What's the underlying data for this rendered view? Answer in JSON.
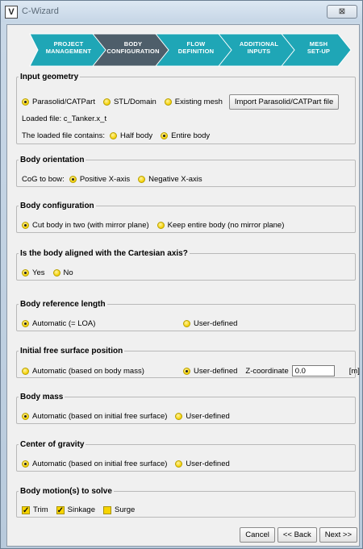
{
  "window": {
    "title": "C-Wizard",
    "close_glyph": "⊠"
  },
  "wizard_steps": [
    {
      "line1": "Project",
      "line2": "Management",
      "active": false
    },
    {
      "line1": "Body",
      "line2": "Configuration",
      "active": true
    },
    {
      "line1": "Flow",
      "line2": "Definition",
      "active": false
    },
    {
      "line1": "Additional",
      "line2": "Inputs",
      "active": false
    },
    {
      "line1": "Mesh",
      "line2": "Set-up",
      "active": false
    }
  ],
  "colors": {
    "step": "#1fa6b6",
    "step_active": "#4e5e6a",
    "accent": "#f5d000"
  },
  "input_geometry": {
    "legend": "Input geometry",
    "opt_parasolid": "Parasolid/CATPart",
    "opt_stl": "STL/Domain",
    "opt_existing": "Existing mesh",
    "import_button": "Import Parasolid/CATPart file",
    "loaded_file": "Loaded file:  c_Tanker.x_t",
    "contains_label": "The loaded file contains:",
    "opt_half": "Half body",
    "opt_entire": "Entire body"
  },
  "body_orientation": {
    "legend": "Body orientation",
    "label": "CoG to bow:",
    "opt_pos": "Positive X-axis",
    "opt_neg": "Negative X-axis"
  },
  "body_configuration": {
    "legend": "Body configuration",
    "opt_cut": "Cut body in two (with mirror plane)",
    "opt_keep": "Keep entire body (no mirror plane)"
  },
  "aligned": {
    "legend": "Is the body aligned with the Cartesian axis?",
    "opt_yes": "Yes",
    "opt_no": "No"
  },
  "ref_length": {
    "legend": "Body reference length",
    "opt_auto": "Automatic (= LOA)",
    "opt_user": "User-defined"
  },
  "free_surface": {
    "legend": "Initial free surface position",
    "opt_auto": "Automatic (based on body mass)",
    "opt_user": "User-defined",
    "z_label": "Z-coordinate",
    "z_value": "0.0",
    "unit": "[m]"
  },
  "body_mass": {
    "legend": "Body mass",
    "opt_auto": "Automatic (based on initial free surface)",
    "opt_user": "User-defined"
  },
  "cog": {
    "legend": "Center of gravity",
    "opt_auto": "Automatic (based on initial free surface)",
    "opt_user": "User-defined"
  },
  "motions": {
    "legend": "Body motion(s) to solve",
    "trim": "Trim",
    "sinkage": "Sinkage",
    "surge": "Surge",
    "check_glyph": "✓"
  },
  "footer": {
    "cancel": "Cancel",
    "back": "<< Back",
    "next": "Next >>"
  }
}
